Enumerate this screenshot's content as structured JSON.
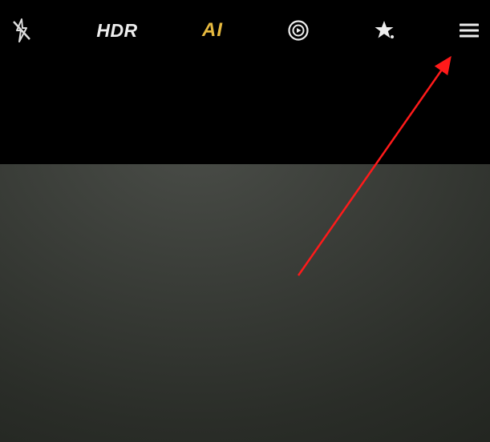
{
  "topbar": {
    "flash": {
      "name": "flash-off-icon"
    },
    "hdr": {
      "label": "HDR"
    },
    "ai": {
      "label": "AI"
    },
    "motion": {
      "name": "motion-photo-icon"
    },
    "filter": {
      "name": "filter-star-icon"
    },
    "menu": {
      "name": "menu-icon"
    }
  },
  "annotation": {
    "arrow_color": "#ff1a1a"
  }
}
